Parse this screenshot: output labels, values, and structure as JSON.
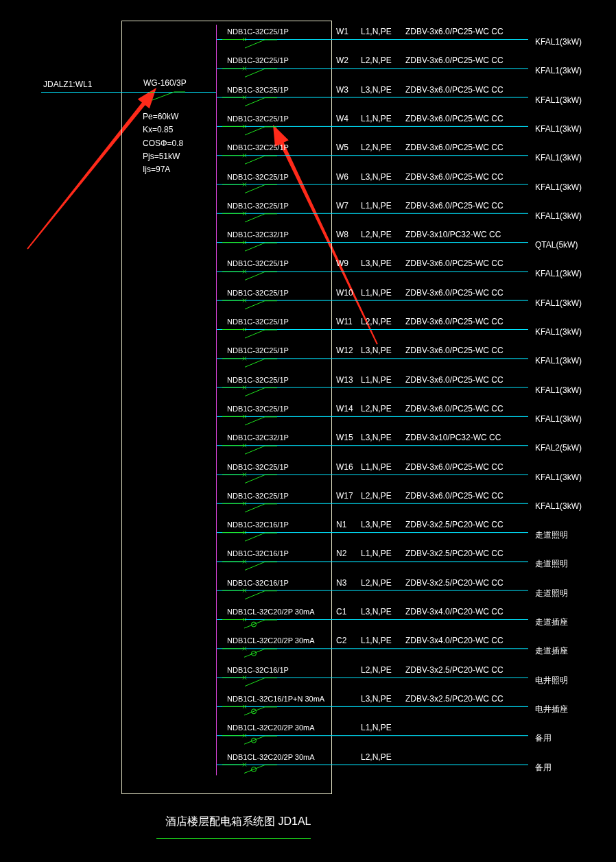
{
  "incoming": {
    "feeder": "JDALZ1:WL1",
    "breaker": "WG-160/3P",
    "params": [
      "Pe=60kW",
      "Kx=0.85",
      "COSΦ=0.8",
      "Pjs=51kW",
      "Ijs=97A"
    ]
  },
  "circuits": [
    {
      "breaker": "NDB1C-32C25/1P",
      "kind": "mcb",
      "circuit": "W1",
      "phase": "L1,N,PE",
      "cable": "ZDBV-3x6.0/PC25-WC CC",
      "load": "KFAL1(3kW)"
    },
    {
      "breaker": "NDB1C-32C25/1P",
      "kind": "mcb",
      "circuit": "W2",
      "phase": "L2,N,PE",
      "cable": "ZDBV-3x6.0/PC25-WC CC",
      "load": "KFAL1(3kW)"
    },
    {
      "breaker": "NDB1C-32C25/1P",
      "kind": "mcb",
      "circuit": "W3",
      "phase": "L3,N,PE",
      "cable": "ZDBV-3x6.0/PC25-WC CC",
      "load": "KFAL1(3kW)"
    },
    {
      "breaker": "NDB1C-32C25/1P",
      "kind": "mcb",
      "circuit": "W4",
      "phase": "L1,N,PE",
      "cable": "ZDBV-3x6.0/PC25-WC CC",
      "load": "KFAL1(3kW)"
    },
    {
      "breaker": "NDB1C-32C25/1P",
      "kind": "mcb",
      "circuit": "W5",
      "phase": "L2,N,PE",
      "cable": "ZDBV-3x6.0/PC25-WC CC",
      "load": "KFAL1(3kW)"
    },
    {
      "breaker": "NDB1C-32C25/1P",
      "kind": "mcb",
      "circuit": "W6",
      "phase": "L3,N,PE",
      "cable": "ZDBV-3x6.0/PC25-WC CC",
      "load": "KFAL1(3kW)"
    },
    {
      "breaker": "NDB1C-32C25/1P",
      "kind": "mcb",
      "circuit": "W7",
      "phase": "L1,N,PE",
      "cable": "ZDBV-3x6.0/PC25-WC CC",
      "load": "KFAL1(3kW)"
    },
    {
      "breaker": "NDB1C-32C32/1P",
      "kind": "mcb",
      "circuit": "W8",
      "phase": "L2,N,PE",
      "cable": "ZDBV-3x10/PC32-WC CC",
      "load": "QTAL(5kW)"
    },
    {
      "breaker": "NDB1C-32C25/1P",
      "kind": "mcb",
      "circuit": "W9",
      "phase": "L3,N,PE",
      "cable": "ZDBV-3x6.0/PC25-WC CC",
      "load": "KFAL1(3kW)"
    },
    {
      "breaker": "NDB1C-32C25/1P",
      "kind": "mcb",
      "circuit": "W10",
      "phase": "L1,N,PE",
      "cable": "ZDBV-3x6.0/PC25-WC CC",
      "load": "KFAL1(3kW)"
    },
    {
      "breaker": "NDB1C-32C25/1P",
      "kind": "mcb",
      "circuit": "W11",
      "phase": "L2,N,PE",
      "cable": "ZDBV-3x6.0/PC25-WC CC",
      "load": "KFAL1(3kW)"
    },
    {
      "breaker": "NDB1C-32C25/1P",
      "kind": "mcb",
      "circuit": "W12",
      "phase": "L3,N,PE",
      "cable": "ZDBV-3x6.0/PC25-WC CC",
      "load": "KFAL1(3kW)"
    },
    {
      "breaker": "NDB1C-32C25/1P",
      "kind": "mcb",
      "circuit": "W13",
      "phase": "L1,N,PE",
      "cable": "ZDBV-3x6.0/PC25-WC CC",
      "load": "KFAL1(3kW)"
    },
    {
      "breaker": "NDB1C-32C25/1P",
      "kind": "mcb",
      "circuit": "W14",
      "phase": "L2,N,PE",
      "cable": "ZDBV-3x6.0/PC25-WC CC",
      "load": "KFAL1(3kW)"
    },
    {
      "breaker": "NDB1C-32C32/1P",
      "kind": "mcb",
      "circuit": "W15",
      "phase": "L3,N,PE",
      "cable": "ZDBV-3x10/PC32-WC CC",
      "load": "KFAL2(5kW)"
    },
    {
      "breaker": "NDB1C-32C25/1P",
      "kind": "mcb",
      "circuit": "W16",
      "phase": "L1,N,PE",
      "cable": "ZDBV-3x6.0/PC25-WC CC",
      "load": "KFAL1(3kW)"
    },
    {
      "breaker": "NDB1C-32C25/1P",
      "kind": "mcb",
      "circuit": "W17",
      "phase": "L2,N,PE",
      "cable": "ZDBV-3x6.0/PC25-WC CC",
      "load": "KFAL1(3kW)"
    },
    {
      "breaker": "NDB1C-32C16/1P",
      "kind": "mcb",
      "circuit": "N1",
      "phase": "L3,N,PE",
      "cable": "ZDBV-3x2.5/PC20-WC CC",
      "load": "走道照明"
    },
    {
      "breaker": "NDB1C-32C16/1P",
      "kind": "mcb",
      "circuit": "N2",
      "phase": "L1,N,PE",
      "cable": "ZDBV-3x2.5/PC20-WC CC",
      "load": "走道照明"
    },
    {
      "breaker": "NDB1C-32C16/1P",
      "kind": "mcb",
      "circuit": "N3",
      "phase": "L2,N,PE",
      "cable": "ZDBV-3x2.5/PC20-WC CC",
      "load": "走道照明"
    },
    {
      "breaker": "NDB1CL-32C20/2P 30mA",
      "kind": "rcbo",
      "circuit": "C1",
      "phase": "L3,N,PE",
      "cable": "ZDBV-3x4.0/PC20-WC CC",
      "load": "走道插座"
    },
    {
      "breaker": "NDB1CL-32C20/2P 30mA",
      "kind": "rcbo",
      "circuit": "C2",
      "phase": "L1,N,PE",
      "cable": "ZDBV-3x4.0/PC20-WC CC",
      "load": "走道插座"
    },
    {
      "breaker": "NDB1C-32C16/1P",
      "kind": "mcb",
      "phase": "L2,N,PE",
      "cable": "ZDBV-3x2.5/PC20-WC CC",
      "load": "电井照明"
    },
    {
      "breaker": "NDB1CL-32C16/1P+N 30mA",
      "kind": "rcbo",
      "phase": "L3,N,PE",
      "cable": "ZDBV-3x2.5/PC20-WC CC",
      "load": "电井插座"
    },
    {
      "breaker": "NDB1CL-32C20/2P 30mA",
      "kind": "rcbo",
      "phase": "L1,N,PE",
      "load": "备用"
    },
    {
      "breaker": "NDB1CL-32C20/2P 30mA",
      "kind": "rcbo",
      "phase": "L2,N,PE",
      "load": "备用"
    }
  ],
  "title": "酒店楼层配电箱系统图 JD1AL"
}
